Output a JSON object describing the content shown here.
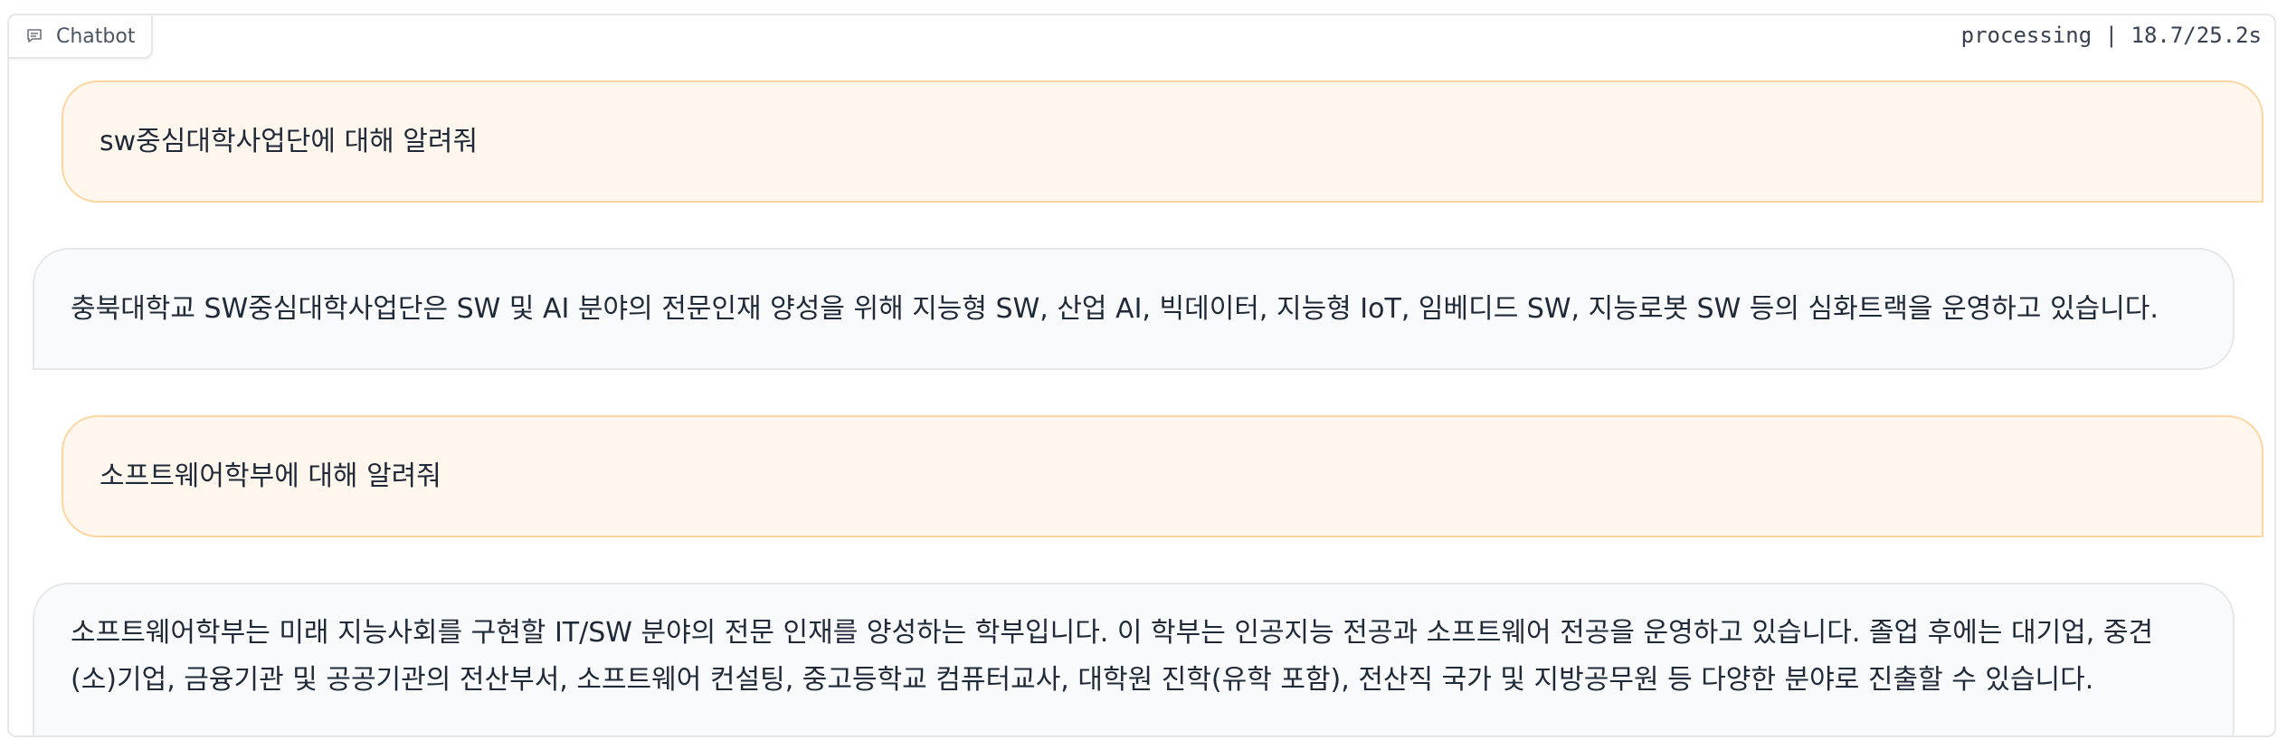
{
  "header": {
    "label": "Chatbot",
    "status": "processing | 18.7/25.2s"
  },
  "icons": {
    "chatbot_label_icon": "chat-bubble-icon"
  },
  "colors": {
    "user_bubble_bg": "#fff7ed",
    "user_bubble_border": "#fcd5a0",
    "bot_bubble_bg": "#f9fafb",
    "bot_bubble_border": "#e5e7eb"
  },
  "messages": [
    {
      "role": "user",
      "text": "sw중심대학사업단에 대해 알려줘"
    },
    {
      "role": "bot",
      "text": "충북대학교 SW중심대학사업단은 SW 및 AI 분야의 전문인재 양성을 위해 지능형 SW, 산업 AI, 빅데이터, 지능형 IoT, 임베디드 SW, 지능로봇 SW 등의 심화트랙을 운영하고 있습니다."
    },
    {
      "role": "user",
      "text": "소프트웨어학부에 대해 알려줘"
    },
    {
      "role": "bot",
      "text": "소프트웨어학부는 미래 지능사회를 구현할 IT/SW 분야의 전문 인재를 양성하는 학부입니다. 이 학부는 인공지능 전공과 소프트웨어 전공을 운영하고 있습니다. 졸업 후에는 대기업, 중견(소)기업, 금융기관 및 공공기관의 전산부서, 소프트웨어 컨설팅, 중고등학교 컴퓨터교사, 대학원 진학(유학 포함), 전산직 국가 및 지방공무원 등 다양한 분야로 진출할 수 있습니다."
    }
  ]
}
